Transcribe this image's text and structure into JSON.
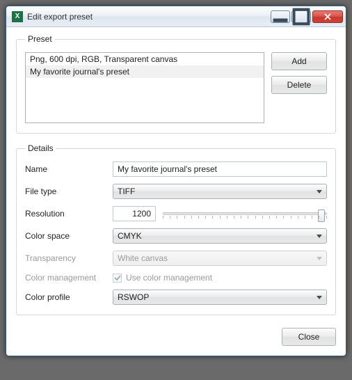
{
  "window": {
    "title": "Edit export preset"
  },
  "preset": {
    "legend": "Preset",
    "items": [
      {
        "label": "Png, 600 dpi, RGB, Transparent canvas",
        "selected": false
      },
      {
        "label": "My favorite journal's preset",
        "selected": true
      }
    ],
    "add_label": "Add",
    "delete_label": "Delete"
  },
  "details": {
    "legend": "Details",
    "name_label": "Name",
    "name_value": "My favorite journal's preset",
    "filetype_label": "File type",
    "filetype_value": "TIFF",
    "resolution_label": "Resolution",
    "resolution_value": "1200",
    "resolution_slider_percent": 97,
    "colorspace_label": "Color space",
    "colorspace_value": "CMYK",
    "transparency_label": "Transparency",
    "transparency_value": "White canvas",
    "transparency_enabled": false,
    "colormgmt_label": "Color management",
    "colormgmt_checkbox_label": "Use color management",
    "colormgmt_checked": true,
    "colormgmt_enabled": false,
    "colorprofile_label": "Color profile",
    "colorprofile_value": "RSWOP"
  },
  "footer": {
    "close_label": "Close"
  }
}
